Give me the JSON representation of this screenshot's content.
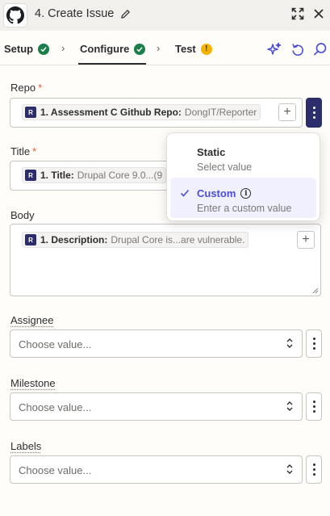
{
  "header": {
    "title": "4. Create Issue"
  },
  "tabs": [
    {
      "label": "Setup",
      "status": "complete"
    },
    {
      "label": "Configure",
      "status": "complete"
    },
    {
      "label": "Test",
      "status": "warning",
      "badge": "!"
    }
  ],
  "toolbar": {
    "icons": [
      "sparkle-icon",
      "undo-icon",
      "search-icon"
    ]
  },
  "fields": {
    "repo": {
      "label": "Repo",
      "required": "*",
      "pill_badge": "R",
      "pill_key": "1. Assessment C Github Repo:",
      "pill_value": "DongIT/Reporter"
    },
    "title": {
      "label": "Title",
      "required": "*",
      "pill_badge": "R",
      "pill_key": "1. Title:",
      "pill_value": "Drupal Core 9.0...(9"
    },
    "body": {
      "label": "Body",
      "pill_badge": "R",
      "pill_key": "1. Description:",
      "pill_value": "Drupal Core is...are vulnerable."
    },
    "assignee": {
      "label": "Assignee",
      "placeholder": "Choose value..."
    },
    "milestone": {
      "label": "Milestone",
      "placeholder": "Choose value..."
    },
    "labels": {
      "label": "Labels",
      "placeholder": "Choose value..."
    }
  },
  "dropdown": {
    "options": [
      {
        "title": "Static",
        "subtitle": "Select value",
        "selected": false
      },
      {
        "title": "Custom",
        "subtitle": "Enter a custom value",
        "selected": true
      }
    ]
  },
  "colors": {
    "accent": "#4a4fd6",
    "brand_navy": "#2b2e6b",
    "success": "#1a7f4a",
    "warning": "#f5b400",
    "required": "#e4572e"
  }
}
